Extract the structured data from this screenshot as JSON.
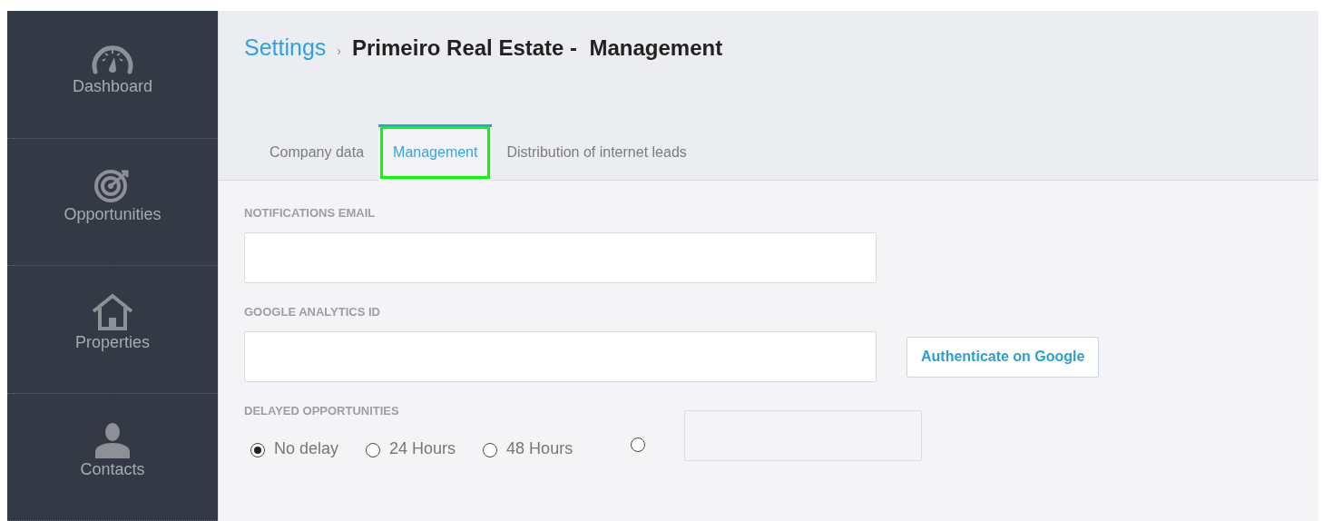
{
  "sidebar": {
    "items": [
      {
        "kind": "gauge",
        "label": "Dashboard"
      },
      {
        "kind": "target",
        "label": "Opportunities"
      },
      {
        "kind": "house",
        "label": "Properties"
      },
      {
        "kind": "person",
        "label": "Contacts"
      }
    ]
  },
  "breadcrumb": {
    "link": "Settings",
    "separator": "›",
    "current": "Primeiro Real Estate -  Management"
  },
  "tabs": [
    {
      "label": "Company data",
      "selected": false,
      "highlighted": false
    },
    {
      "label": "Management",
      "selected": true,
      "highlighted": true
    },
    {
      "label": "Distribution of internet leads",
      "selected": false,
      "highlighted": false
    }
  ],
  "form": {
    "notifications_email": {
      "label": "NOTIFICATIONS EMAIL"
    },
    "google_analytics_id": {
      "label": "GOOGLE ANALYTICS ID",
      "button": "Authenticate on Google"
    },
    "delayed_opportunities": {
      "label": "DELAYED OPPORTUNITIES",
      "options": [
        {
          "kind": "option",
          "label": "No delay",
          "selected": true
        },
        {
          "kind": "option",
          "label": "24 Hours",
          "selected": false
        },
        {
          "kind": "option",
          "label": "48 Hours",
          "selected": false
        },
        {
          "kind": "custom",
          "selected": false
        }
      ]
    }
  }
}
